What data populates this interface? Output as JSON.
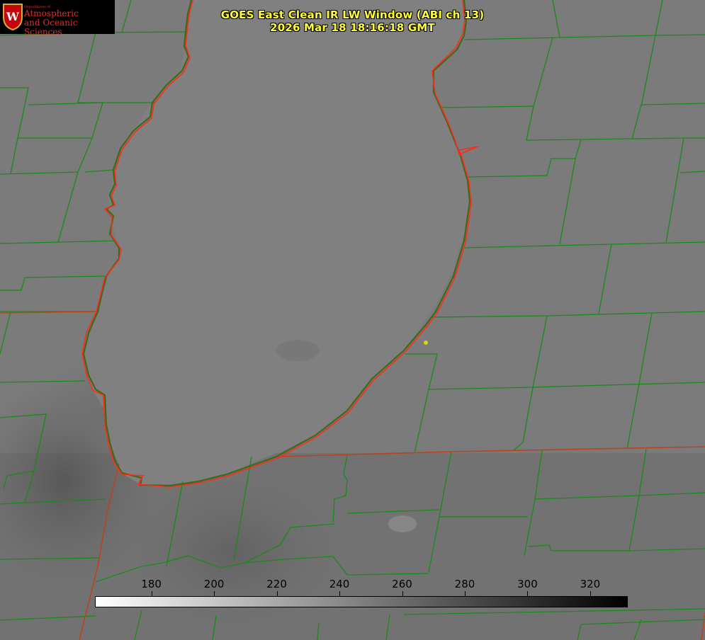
{
  "title": {
    "line1": "GOES East Clean IR LW Window (ABI ch 13)",
    "line2": "2026 Mar 18 18:16:18 GMT"
  },
  "logo": {
    "small": "Department of",
    "line1": "Atmospheric",
    "line2": "and Oceanic Sciences",
    "icon": "uw-crest-icon"
  },
  "colorbar": {
    "ticks": [
      "180",
      "200",
      "220",
      "240",
      "260",
      "280",
      "300",
      "320"
    ],
    "range": [
      162,
      332
    ],
    "gradient": [
      "#ffffff",
      "#000000"
    ]
  },
  "colors": {
    "county_lines": "#1a8a1a",
    "lake_outline": "#ff2a1a",
    "state_lines": "#b84420",
    "title_text": "#ffff33",
    "marker": "#e0d020"
  }
}
